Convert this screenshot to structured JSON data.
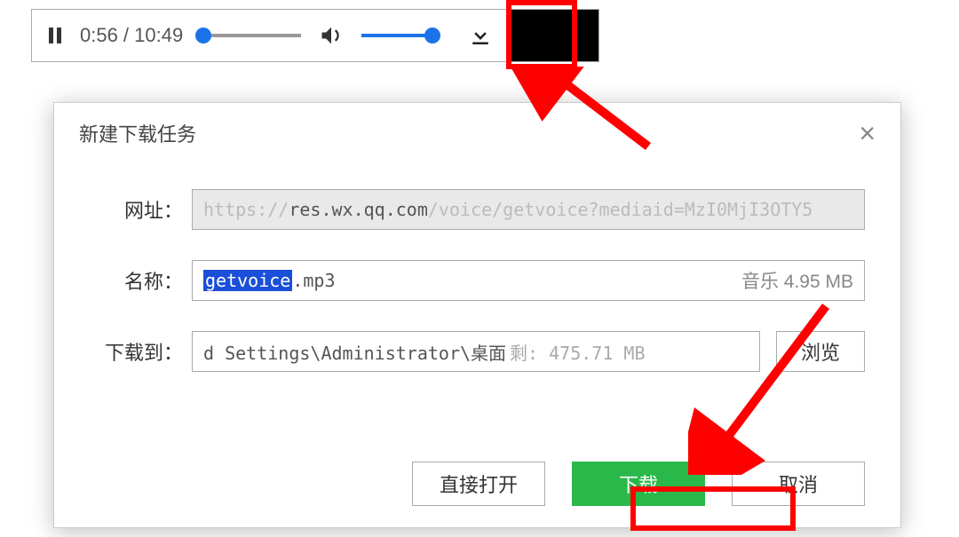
{
  "player": {
    "time_current": "0:56",
    "time_total": "10:49",
    "time_display": "0:56 / 10:49",
    "pause_icon": "pause-icon",
    "volume_icon": "volume-icon",
    "download_icon": "download-icon"
  },
  "dialog": {
    "title": "新建下载任务",
    "close": "×",
    "url_label": "网址：",
    "url_prefix": "https://",
    "url_host": "res.wx.qq.com",
    "url_suffix": "/voice/getvoice?mediaid=MzI0MjI3OTY5",
    "name_label": "名称：",
    "name_selected": "getvoice",
    "name_ext": ".mp3",
    "file_type": "音乐",
    "file_size": "4.95 MB",
    "path_label": "下载到：",
    "path_value": "d Settings\\Administrator\\桌面",
    "path_remaining_label": "剩:",
    "path_remaining_value": "475.71 MB",
    "browse": "浏览",
    "open_direct": "直接打开",
    "download": "下载",
    "cancel": "取消"
  }
}
